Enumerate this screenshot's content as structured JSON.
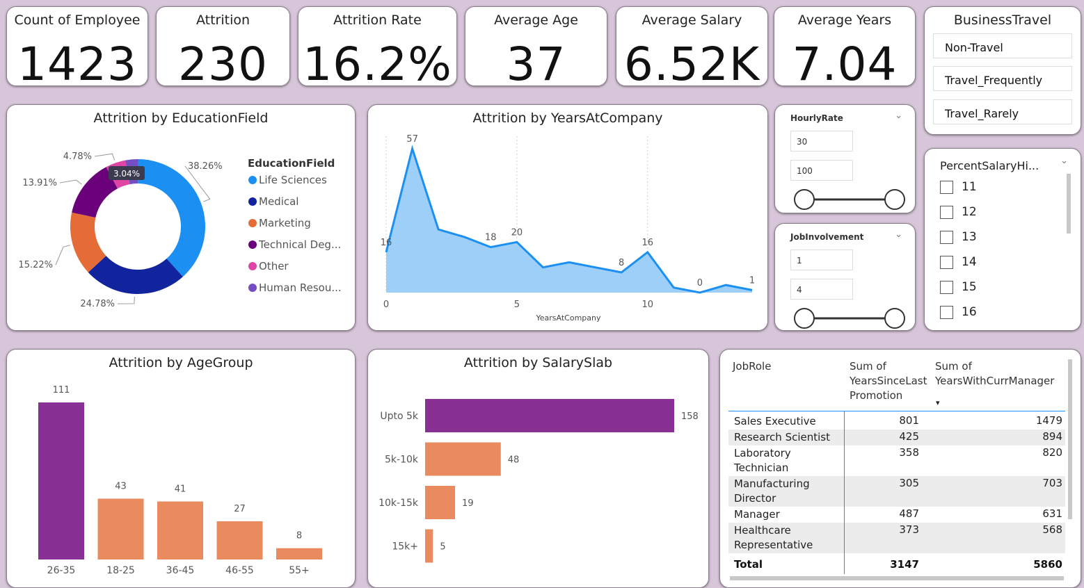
{
  "kpis": [
    {
      "label": "Count of Employee",
      "value": "1423"
    },
    {
      "label": "Attrition",
      "value": "230"
    },
    {
      "label": "Attrition Rate",
      "value": "16.2%"
    },
    {
      "label": "Average Age",
      "value": "37"
    },
    {
      "label": "Average Salary",
      "value": "6.52K"
    },
    {
      "label": "Average Years",
      "value": "7.04"
    }
  ],
  "business_travel": {
    "title": "BusinessTravel",
    "items": [
      "Non-Travel",
      "Travel_Frequently",
      "Travel_Rarely"
    ]
  },
  "hourly_rate": {
    "title": "HourlyRate",
    "min": "30",
    "max": "100",
    "chevron": "chevron-down-icon"
  },
  "job_involvement": {
    "title": "JobInvolvement",
    "min": "1",
    "max": "4",
    "chevron": "chevron-down-icon"
  },
  "percent_salary": {
    "title": "PercentSalaryHi...",
    "items": [
      "11",
      "12",
      "13",
      "14",
      "15",
      "16"
    ]
  },
  "education_chart": {
    "title": "Attrition by EducationField",
    "legend_title": "EducationField",
    "slice_labels": [
      "38.26%",
      "24.78%",
      "15.22%",
      "13.91%",
      "4.78%",
      "3.04%"
    ]
  },
  "years_chart": {
    "title": "Attrition by YearsAtCompany",
    "xlabel": "YearsAtCompany",
    "x_ticks": [
      "0",
      "5",
      "10"
    ]
  },
  "age_chart": {
    "title": "Attrition by AgeGroup"
  },
  "salary_chart": {
    "title": "Attrition by SalarySlab"
  },
  "jobrole_table": {
    "headers": [
      "JobRole",
      "Sum of YearsSinceLast Promotion",
      "Sum of YearsWithCurrManager"
    ],
    "header_lines": [
      [
        "JobRole"
      ],
      [
        "Sum of",
        "YearsSinceLast",
        "Promotion"
      ],
      [
        "Sum of",
        "YearsWithCurrManager"
      ]
    ],
    "rows": [
      {
        "role": [
          "Sales Executive"
        ],
        "promo": "801",
        "mgr": "1479"
      },
      {
        "role": [
          "Research Scientist"
        ],
        "promo": "425",
        "mgr": "894"
      },
      {
        "role": [
          "Laboratory",
          "Technician"
        ],
        "promo": "358",
        "mgr": "820"
      },
      {
        "role": [
          "Manufacturing",
          "Director"
        ],
        "promo": "305",
        "mgr": "703"
      },
      {
        "role": [
          "Manager"
        ],
        "promo": "487",
        "mgr": "631"
      },
      {
        "role": [
          "Healthcare",
          "Representative"
        ],
        "promo": "373",
        "mgr": "568"
      }
    ],
    "total": {
      "label": "Total",
      "promo": "3147",
      "mgr": "5860"
    }
  },
  "colors": {
    "background": "#d7c6d9",
    "purple": "#883093",
    "orange": "#e98a5f",
    "area_fill": "#9ecff9",
    "area_line": "#1c8ff2",
    "life_sciences": "#1c8ff2",
    "medical": "#12239e",
    "marketing": "#e66c37",
    "technical": "#6b007b",
    "other": "#e044a7",
    "human_resources": "#744ec2"
  },
  "chart_data": [
    {
      "type": "pie",
      "title": "Attrition by EducationField",
      "legend_title": "EducationField",
      "categories": [
        "Life Sciences",
        "Medical",
        "Marketing",
        "Technical Deg...",
        "Other",
        "Human Resou..."
      ],
      "values": [
        38.26,
        24.78,
        15.22,
        13.91,
        4.78,
        3.04
      ],
      "legend": "right"
    },
    {
      "type": "area",
      "title": "Attrition by YearsAtCompany",
      "xlabel": "YearsAtCompany",
      "x": [
        0,
        1,
        2,
        3,
        4,
        5,
        6,
        7,
        8,
        9,
        10,
        11,
        12,
        13,
        14
      ],
      "values": [
        16,
        57,
        25,
        22,
        18,
        20,
        10,
        12,
        10,
        8,
        16,
        2,
        0,
        3,
        1
      ],
      "labeled": {
        "0": "16",
        "1": "57",
        "4": "18",
        "5": "20",
        "9": "8",
        "10": "16",
        "12": "0",
        "14": "1"
      },
      "xlim": [
        0,
        14
      ],
      "ylim": [
        0,
        60
      ],
      "x_ticks": [
        0,
        5,
        10
      ],
      "grid": "vertical dotted"
    },
    {
      "type": "bar",
      "title": "Attrition by AgeGroup",
      "categories": [
        "26-35",
        "18-25",
        "36-45",
        "46-55",
        "55+"
      ],
      "values": [
        111,
        43,
        41,
        27,
        8
      ],
      "ylim": [
        0,
        111
      ]
    },
    {
      "type": "bar",
      "orientation": "horizontal",
      "title": "Attrition by SalarySlab",
      "categories": [
        "Upto 5k",
        "5k-10k",
        "10k-15k",
        "15k+"
      ],
      "values": [
        158,
        48,
        19,
        5
      ],
      "xlim": [
        0,
        158
      ]
    }
  ]
}
